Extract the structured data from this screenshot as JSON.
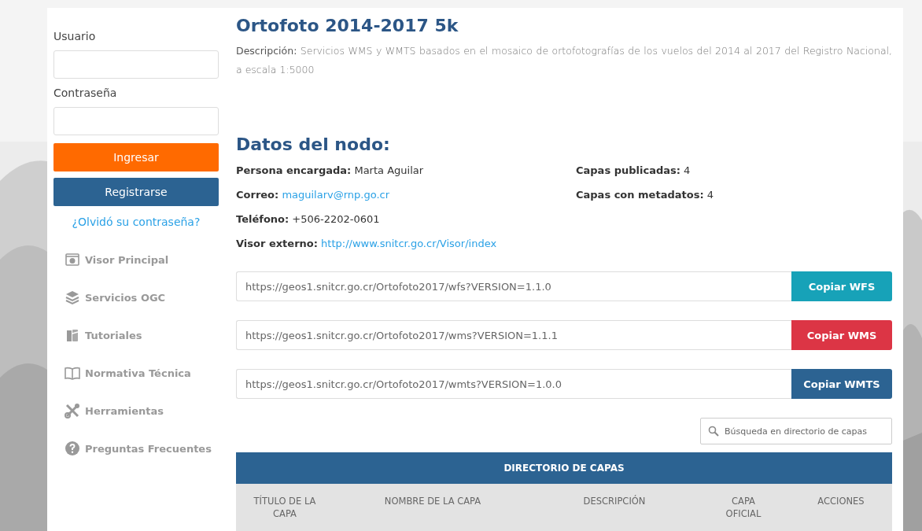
{
  "login": {
    "user_label": "Usuario",
    "password_label": "Contraseña",
    "login_button": "Ingresar",
    "register_button": "Registrarse",
    "forgot_link": "¿Olvidó su contraseña?"
  },
  "nav": [
    {
      "label": "Visor Principal",
      "kind": "viewer"
    },
    {
      "label": "Servicios OGC",
      "kind": "layers"
    },
    {
      "label": "Tutoriales",
      "kind": "books"
    },
    {
      "label": "Normativa Técnica",
      "kind": "book"
    },
    {
      "label": "Herramientas",
      "kind": "tools"
    },
    {
      "label": "Preguntas Frecuentes",
      "kind": "help"
    }
  ],
  "title": "Ortofoto 2014-2017 5k",
  "description": {
    "label": "Descripción:",
    "text": "Servicios WMS y WMTS basados en el mosaico de ortofotografías de los vuelos del 2014 al 2017 del Registro Nacional, a escala 1:5000"
  },
  "node": {
    "heading": "Datos del nodo:",
    "left": [
      {
        "label": "Persona encargada:",
        "value": "Marta Aguilar",
        "kind": "text"
      },
      {
        "label": "Correo:",
        "value": "maguilarv@rnp.go.cr",
        "kind": "link"
      },
      {
        "label": "Teléfono:",
        "value": "+506-2202-0601",
        "kind": "text"
      },
      {
        "label": "Visor externo:",
        "value": "http://www.snitcr.go.cr/Visor/index",
        "kind": "link"
      }
    ],
    "right": [
      {
        "label": "Capas publicadas:",
        "value": "4"
      },
      {
        "label": "Capas con metadatos:",
        "value": "4"
      }
    ]
  },
  "services": [
    {
      "url": "https://geos1.snitcr.go.cr/Ortofoto2017/wfs?VERSION=1.1.0",
      "button": "Copiar WFS",
      "color": "#17a2b8"
    },
    {
      "url": "https://geos1.snitcr.go.cr/Ortofoto2017/wms?VERSION=1.1.1",
      "button": "Copiar WMS",
      "color": "#dc3545"
    },
    {
      "url": "https://geos1.snitcr.go.cr/Ortofoto2017/wmts?VERSION=1.0.0",
      "button": "Copiar WMTS",
      "color": "#2c6392"
    }
  ],
  "search": {
    "placeholder": "Búsqueda en directorio de capas"
  },
  "table": {
    "title": "DIRECTORIO DE CAPAS",
    "columns": [
      "TÍTULO DE LA CAPA",
      "NOMBRE DE LA CAPA",
      "DESCRIPCIÓN",
      "CAPA OFICIAL",
      "ACCIONES"
    ]
  }
}
